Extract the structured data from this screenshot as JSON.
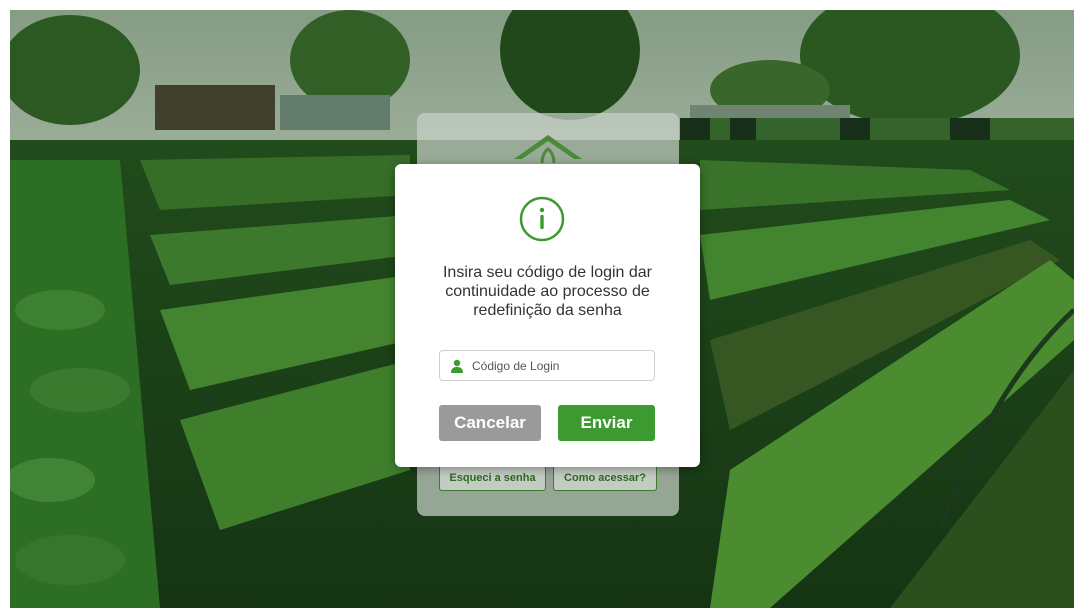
{
  "background": {
    "description_icon": "garden-background"
  },
  "back_card": {
    "logo_icon": "house-leaf-logo-icon",
    "forgot_label": "Esqueci a senha",
    "how_label": "Como acessar?"
  },
  "dialog": {
    "icon": "info-icon",
    "message": "Insira seu código de login dar continuidade ao processo de redefinição da senha",
    "login_placeholder": "Código de Login",
    "login_value": "",
    "cancel_label": "Cancelar",
    "send_label": "Enviar"
  },
  "colors": {
    "accent_green": "#3d9a30",
    "cancel_gray": "#9a9a9a",
    "text_dark": "#333333"
  }
}
